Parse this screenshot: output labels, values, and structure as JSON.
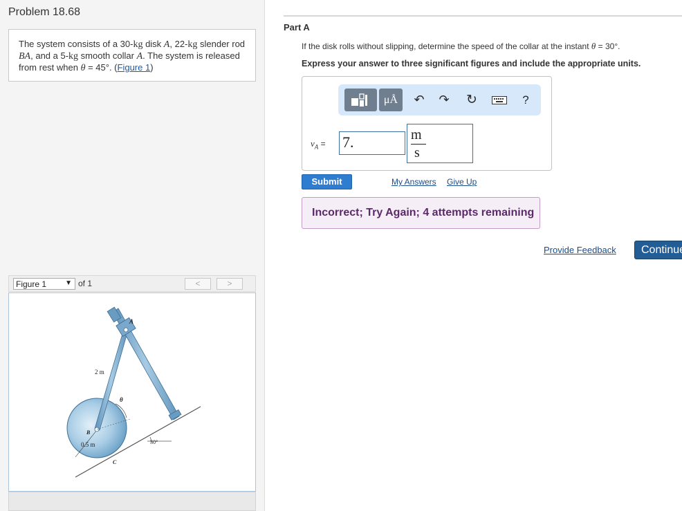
{
  "problem": {
    "title": "Problem 18.68",
    "statement": {
      "t1": "The system consists of a 30-",
      "kg1": "kg",
      "t2": " disk ",
      "A1": "A",
      "t3": ", 22-",
      "kg2": "kg",
      "t4": " slender rod ",
      "BA": "BA",
      "t5": ", and a 5-",
      "kg3": "kg",
      "t6": " smooth collar ",
      "A2": "A",
      "t7": ". The system is released from rest when ",
      "theta": "θ",
      "t8": " = 45°. (",
      "figure_link": "Figure 1",
      "t9": ")"
    }
  },
  "figure_nav": {
    "selected": "Figure 1",
    "of_label": "of 1",
    "prev_icon": "chevron-left",
    "next_icon": "chevron-right",
    "prev_glyph": "<",
    "next_glyph": ">"
  },
  "figure": {
    "labels": {
      "A": "A",
      "B": "B",
      "C": "C",
      "theta": "θ",
      "rod_length": "2 m",
      "radius": "0.5 m",
      "incline_angle": "30°"
    },
    "colors": {
      "disk": "#8fbcd9",
      "rod": "#7aa9cc",
      "incline": "#555555"
    }
  },
  "part": {
    "label": "Part A",
    "question": {
      "text": "If the disk rolls without slipping, determine the speed of the collar at the instant ",
      "theta": "θ",
      "tail": " = 30°."
    },
    "instructions": "Express your answer to three significant figures and include the appropriate units."
  },
  "toolbar": {
    "units_label": "μÅ",
    "undo_glyph": "↶",
    "redo_glyph": "↷",
    "reset_glyph": "↻",
    "help_label": "?",
    "icons": [
      "templates-icon",
      "units-icon",
      "undo-icon",
      "redo-icon",
      "reset-icon",
      "keyboard-icon",
      "help-icon"
    ]
  },
  "answer": {
    "var_symbol": "v",
    "var_sub": "A",
    "equals": " =",
    "value": "7.",
    "unit_numerator": "m",
    "unit_denominator": "s"
  },
  "actions": {
    "submit_label": "Submit",
    "my_answers_label": "My Answers",
    "give_up_label": "Give Up"
  },
  "feedback": {
    "message": "Incorrect; Try Again; 4 attempts remaining",
    "color": "#5b2a68"
  },
  "footer": {
    "provide_feedback_label": "Provide Feedback",
    "continue_label": "Continue"
  }
}
